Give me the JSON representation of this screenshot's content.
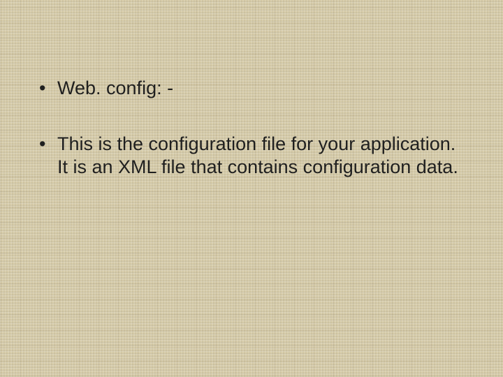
{
  "slide": {
    "bullets": [
      "Web. config: -",
      "This is the configuration file for your application. It is an XML file that contains configuration data."
    ]
  }
}
